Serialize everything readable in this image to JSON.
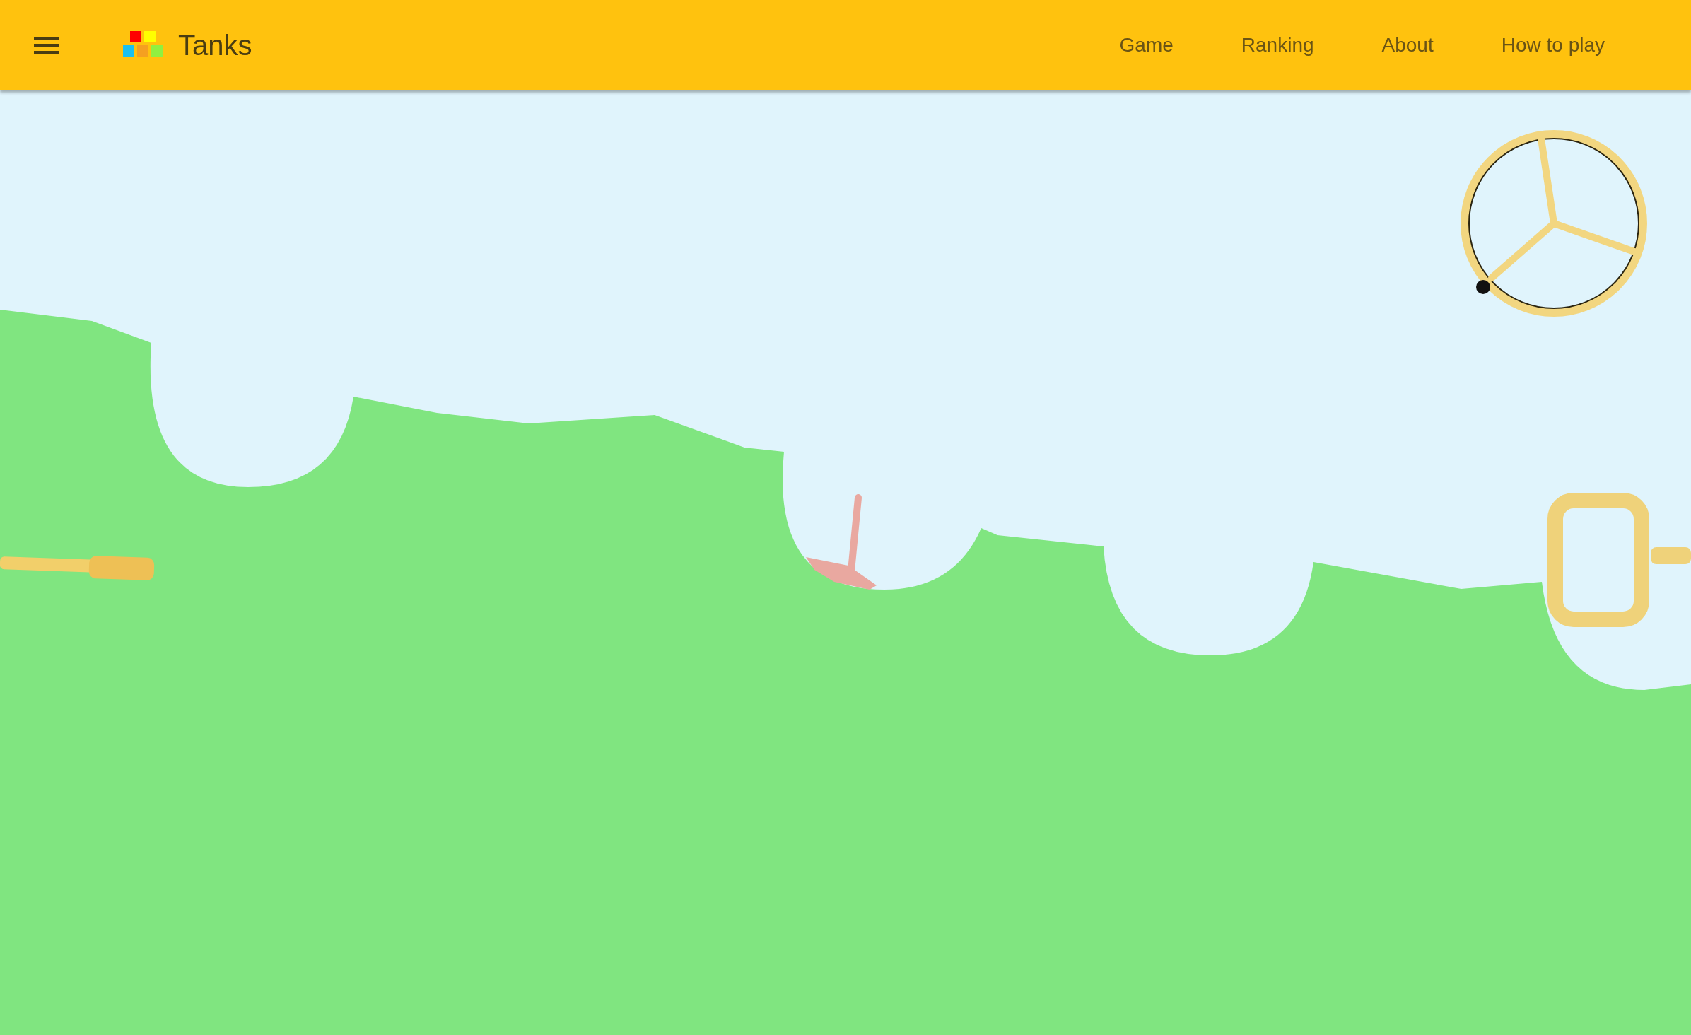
{
  "app_bar": {
    "title": "Tanks",
    "nav": [
      {
        "label": "Game"
      },
      {
        "label": "Ranking"
      },
      {
        "label": "About"
      },
      {
        "label": "How to play"
      }
    ]
  }
}
